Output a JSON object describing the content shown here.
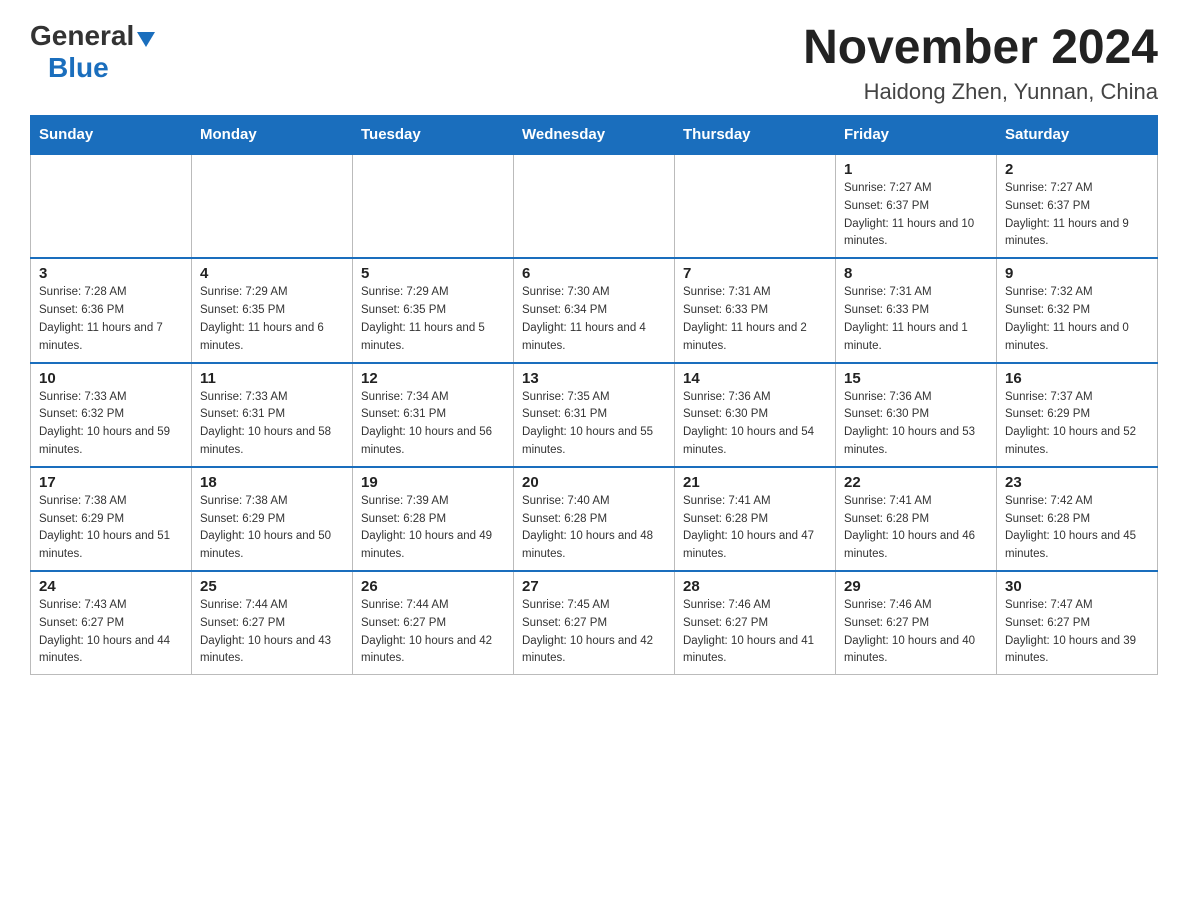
{
  "header": {
    "logo_general": "General",
    "logo_blue": "Blue",
    "month_title": "November 2024",
    "location": "Haidong Zhen, Yunnan, China"
  },
  "days_of_week": [
    "Sunday",
    "Monday",
    "Tuesday",
    "Wednesday",
    "Thursday",
    "Friday",
    "Saturday"
  ],
  "weeks": [
    [
      {
        "day": "",
        "sunrise": "",
        "sunset": "",
        "daylight": ""
      },
      {
        "day": "",
        "sunrise": "",
        "sunset": "",
        "daylight": ""
      },
      {
        "day": "",
        "sunrise": "",
        "sunset": "",
        "daylight": ""
      },
      {
        "day": "",
        "sunrise": "",
        "sunset": "",
        "daylight": ""
      },
      {
        "day": "",
        "sunrise": "",
        "sunset": "",
        "daylight": ""
      },
      {
        "day": "1",
        "sunrise": "Sunrise: 7:27 AM",
        "sunset": "Sunset: 6:37 PM",
        "daylight": "Daylight: 11 hours and 10 minutes."
      },
      {
        "day": "2",
        "sunrise": "Sunrise: 7:27 AM",
        "sunset": "Sunset: 6:37 PM",
        "daylight": "Daylight: 11 hours and 9 minutes."
      }
    ],
    [
      {
        "day": "3",
        "sunrise": "Sunrise: 7:28 AM",
        "sunset": "Sunset: 6:36 PM",
        "daylight": "Daylight: 11 hours and 7 minutes."
      },
      {
        "day": "4",
        "sunrise": "Sunrise: 7:29 AM",
        "sunset": "Sunset: 6:35 PM",
        "daylight": "Daylight: 11 hours and 6 minutes."
      },
      {
        "day": "5",
        "sunrise": "Sunrise: 7:29 AM",
        "sunset": "Sunset: 6:35 PM",
        "daylight": "Daylight: 11 hours and 5 minutes."
      },
      {
        "day": "6",
        "sunrise": "Sunrise: 7:30 AM",
        "sunset": "Sunset: 6:34 PM",
        "daylight": "Daylight: 11 hours and 4 minutes."
      },
      {
        "day": "7",
        "sunrise": "Sunrise: 7:31 AM",
        "sunset": "Sunset: 6:33 PM",
        "daylight": "Daylight: 11 hours and 2 minutes."
      },
      {
        "day": "8",
        "sunrise": "Sunrise: 7:31 AM",
        "sunset": "Sunset: 6:33 PM",
        "daylight": "Daylight: 11 hours and 1 minute."
      },
      {
        "day": "9",
        "sunrise": "Sunrise: 7:32 AM",
        "sunset": "Sunset: 6:32 PM",
        "daylight": "Daylight: 11 hours and 0 minutes."
      }
    ],
    [
      {
        "day": "10",
        "sunrise": "Sunrise: 7:33 AM",
        "sunset": "Sunset: 6:32 PM",
        "daylight": "Daylight: 10 hours and 59 minutes."
      },
      {
        "day": "11",
        "sunrise": "Sunrise: 7:33 AM",
        "sunset": "Sunset: 6:31 PM",
        "daylight": "Daylight: 10 hours and 58 minutes."
      },
      {
        "day": "12",
        "sunrise": "Sunrise: 7:34 AM",
        "sunset": "Sunset: 6:31 PM",
        "daylight": "Daylight: 10 hours and 56 minutes."
      },
      {
        "day": "13",
        "sunrise": "Sunrise: 7:35 AM",
        "sunset": "Sunset: 6:31 PM",
        "daylight": "Daylight: 10 hours and 55 minutes."
      },
      {
        "day": "14",
        "sunrise": "Sunrise: 7:36 AM",
        "sunset": "Sunset: 6:30 PM",
        "daylight": "Daylight: 10 hours and 54 minutes."
      },
      {
        "day": "15",
        "sunrise": "Sunrise: 7:36 AM",
        "sunset": "Sunset: 6:30 PM",
        "daylight": "Daylight: 10 hours and 53 minutes."
      },
      {
        "day": "16",
        "sunrise": "Sunrise: 7:37 AM",
        "sunset": "Sunset: 6:29 PM",
        "daylight": "Daylight: 10 hours and 52 minutes."
      }
    ],
    [
      {
        "day": "17",
        "sunrise": "Sunrise: 7:38 AM",
        "sunset": "Sunset: 6:29 PM",
        "daylight": "Daylight: 10 hours and 51 minutes."
      },
      {
        "day": "18",
        "sunrise": "Sunrise: 7:38 AM",
        "sunset": "Sunset: 6:29 PM",
        "daylight": "Daylight: 10 hours and 50 minutes."
      },
      {
        "day": "19",
        "sunrise": "Sunrise: 7:39 AM",
        "sunset": "Sunset: 6:28 PM",
        "daylight": "Daylight: 10 hours and 49 minutes."
      },
      {
        "day": "20",
        "sunrise": "Sunrise: 7:40 AM",
        "sunset": "Sunset: 6:28 PM",
        "daylight": "Daylight: 10 hours and 48 minutes."
      },
      {
        "day": "21",
        "sunrise": "Sunrise: 7:41 AM",
        "sunset": "Sunset: 6:28 PM",
        "daylight": "Daylight: 10 hours and 47 minutes."
      },
      {
        "day": "22",
        "sunrise": "Sunrise: 7:41 AM",
        "sunset": "Sunset: 6:28 PM",
        "daylight": "Daylight: 10 hours and 46 minutes."
      },
      {
        "day": "23",
        "sunrise": "Sunrise: 7:42 AM",
        "sunset": "Sunset: 6:28 PM",
        "daylight": "Daylight: 10 hours and 45 minutes."
      }
    ],
    [
      {
        "day": "24",
        "sunrise": "Sunrise: 7:43 AM",
        "sunset": "Sunset: 6:27 PM",
        "daylight": "Daylight: 10 hours and 44 minutes."
      },
      {
        "day": "25",
        "sunrise": "Sunrise: 7:44 AM",
        "sunset": "Sunset: 6:27 PM",
        "daylight": "Daylight: 10 hours and 43 minutes."
      },
      {
        "day": "26",
        "sunrise": "Sunrise: 7:44 AM",
        "sunset": "Sunset: 6:27 PM",
        "daylight": "Daylight: 10 hours and 42 minutes."
      },
      {
        "day": "27",
        "sunrise": "Sunrise: 7:45 AM",
        "sunset": "Sunset: 6:27 PM",
        "daylight": "Daylight: 10 hours and 42 minutes."
      },
      {
        "day": "28",
        "sunrise": "Sunrise: 7:46 AM",
        "sunset": "Sunset: 6:27 PM",
        "daylight": "Daylight: 10 hours and 41 minutes."
      },
      {
        "day": "29",
        "sunrise": "Sunrise: 7:46 AM",
        "sunset": "Sunset: 6:27 PM",
        "daylight": "Daylight: 10 hours and 40 minutes."
      },
      {
        "day": "30",
        "sunrise": "Sunrise: 7:47 AM",
        "sunset": "Sunset: 6:27 PM",
        "daylight": "Daylight: 10 hours and 39 minutes."
      }
    ]
  ]
}
